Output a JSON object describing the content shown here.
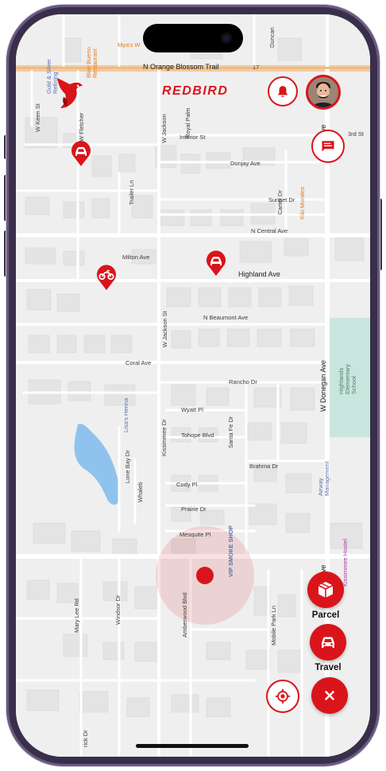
{
  "app": {
    "brand": "REDBIRD",
    "colors": {
      "accent": "#d9151b",
      "map_bg": "#efefef",
      "road": "#ffffff",
      "highway": "#f3c99a",
      "water": "#8fc3ee",
      "park": "#c9e6de"
    }
  },
  "header": {
    "notification_icon": "bell-icon",
    "chat_icon": "chat-icon",
    "avatar_icon": "user-avatar"
  },
  "map": {
    "streets": {
      "n_orange_blossom": "N Orange Blossom Trail",
      "interior": "Interior St",
      "donjay": "Donjay Ave",
      "sunset": "Sunset Dr",
      "n_central": "N Central Ave",
      "milton": "Milton Ave",
      "highland": "Highland Ave",
      "n_beaumont": "N Beaumont Ave",
      "coral": "Coral Ave",
      "rancho": "Rancho Dr",
      "wyatt": "Wyatt Pl",
      "tohope": "Tohope Blvd",
      "brahma": "Brahma Dr",
      "cody": "Cody Pl",
      "prairie": "Prairie Dr",
      "mesquite": "Mesquite Pl",
      "w_keen": "W Keen St",
      "w_fletcher": "W Fletcher",
      "trailer": "Trailer Ln",
      "w_jackson_top": "W Jackson",
      "w_jackson": "W Jackson St",
      "royal_palm": "Royal Palm",
      "carter": "Carter Dr",
      "kissimmee": "Kissimmee Dr",
      "santa_fe": "Santa Fe Dr",
      "w_donegan": "W Donegan Ave",
      "donegan_ave": "Ave",
      "lone_bay": "Lone Bay Dr",
      "whaleb": "Whaleb",
      "mary_lee": "Mary Lee Rd",
      "windsor": "Windsor Dr",
      "amberwood": "Amberwood Blvd",
      "mobile_park": "Mobile Park Ln",
      "rick": "rick Dr",
      "duncan": "Duncan",
      "third": "3rd St",
      "route": "17"
    },
    "pois": {
      "gold_silver": "Gold & Silver Refining",
      "mya": "Mya's W",
      "blue_bueno": "Blue Bueno Restaurant",
      "kiki": "Kiki Morales",
      "lisa": "Lisa's Henna",
      "vip": "VIP SMOKE SHOP",
      "airway": "Airway Management",
      "highlands": "Highlands Elementary School",
      "kissimmee_hostel": "Kissimmee Hostel"
    }
  },
  "actions": {
    "parcel": {
      "label": "Parcel",
      "icon": "box-icon"
    },
    "travel": {
      "label": "Travel",
      "icon": "car-icon"
    },
    "locate_icon": "crosshair-icon",
    "close_icon": "close-icon"
  }
}
